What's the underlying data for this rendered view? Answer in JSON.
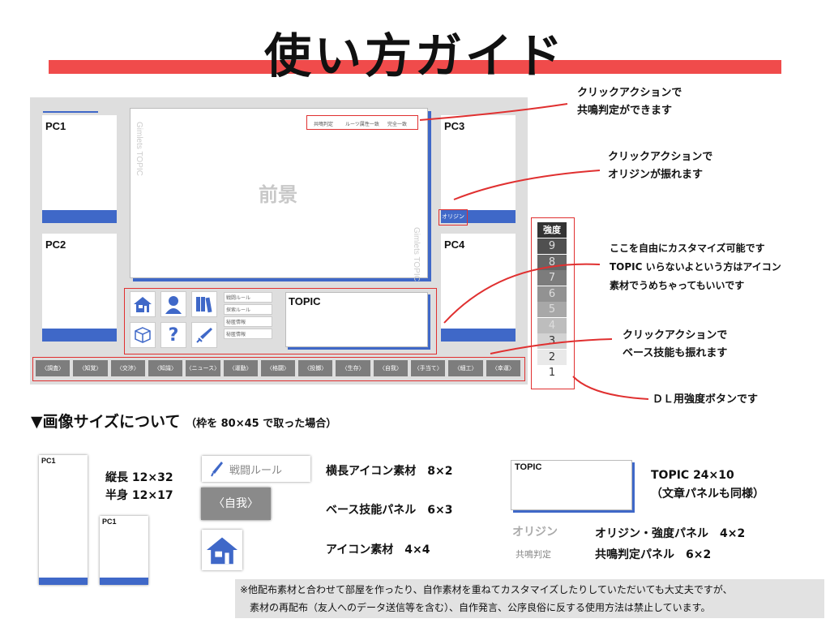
{
  "title": "使い方ガイド",
  "mock": {
    "pc_cards": [
      "PC1",
      "PC2",
      "PC3",
      "PC4"
    ],
    "foreground_label": "前景",
    "watermark": "Gimlets TOPIC",
    "resonance_tags": [
      "共鳴判定",
      "ルーツ属性一致",
      "完全一致"
    ],
    "origin_button": "オリジン",
    "small_icons": [
      "戦闘ルール",
      "探索ルール",
      "秘匿情報",
      "秘匿情報"
    ],
    "topic_label": "TOPIC",
    "tabs": [
      "〈調査〉",
      "〈知覚〉",
      "〈交渉〉",
      "〈知識〉",
      "〈ニュース〉",
      "〈運動〉",
      "〈格闘〉",
      "〈投擲〉",
      "〈生存〉",
      "〈自我〉",
      "〈手当て〉",
      "〈細工〉",
      "〈幸運〉"
    ],
    "strength": {
      "header": "強度",
      "levels": [
        "9",
        "8",
        "7",
        "6",
        "5",
        "4",
        "3",
        "2",
        "1"
      ]
    }
  },
  "annotations": {
    "resonance": [
      "クリックアクションで",
      "共鳴判定ができます"
    ],
    "origin": [
      "クリックアクションで",
      "オリジンが振れます"
    ],
    "customize": [
      "ここを自由にカスタマイズ可能です",
      "TOPIC いらないよという方はアイコン",
      "素材でうめちゃってもいいです"
    ],
    "base_skill": [
      "クリックアクションで",
      "ベース技能も振れます"
    ],
    "dl": "ＤＬ用強度ボタンです"
  },
  "size_section": {
    "heading": "▼画像サイズについて",
    "heading_note": "（枠を 80×45 で取った場合）",
    "pc_sample": "PC1",
    "card_sizes": [
      "縦長 12×32",
      "半身 12×17"
    ],
    "icon_long_label": "戦闘ルール",
    "icon_long_desc": "横長アイコン素材　8×2",
    "base_panel_label": "〈自我〉",
    "base_panel_desc": "ベース技能パネル　6×3",
    "icon_desc": "アイコン素材　4×4",
    "topic_sample": "TOPIC",
    "topic_desc": [
      "TOPIC 24×10",
      "（文章パネルも同様）"
    ],
    "origin_sample": "オリジン",
    "origin_desc": "オリジン・強度パネル　4×2",
    "resonance_sample": "共鳴判定",
    "resonance_desc": "共鳴判定パネル　6×2"
  },
  "note": [
    "※他配布素材と合わせて部屋を作ったり、自作素材を重ねてカスタマイズしたりしていただいても大丈夫ですが、",
    "　素材の再配布（友人へのデータ送信等を含む）、自作発言、公序良俗に反する使用方法は禁止しています。"
  ],
  "colors": {
    "accent_blue": "#3f68c8",
    "accent_red": "#f04b4b"
  }
}
